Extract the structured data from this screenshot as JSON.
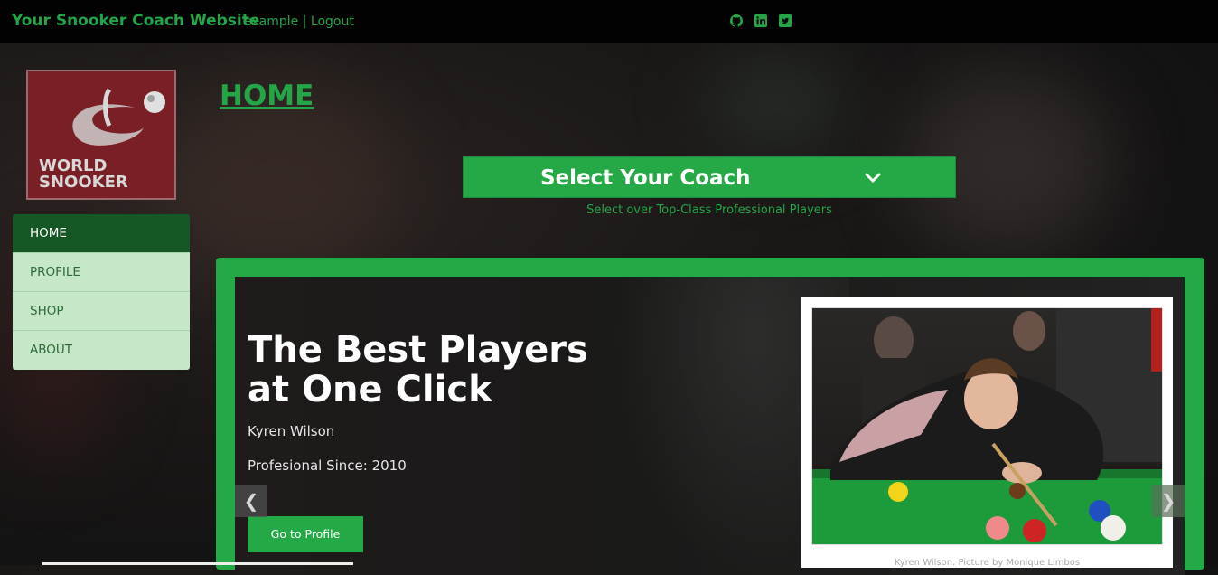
{
  "topbar": {
    "brand": "Your Snooker Coach Website",
    "username": "example",
    "separator": "|",
    "logout": "Logout",
    "social": [
      "github-icon",
      "linkedin-icon",
      "twitter-icon"
    ]
  },
  "logo": {
    "line1": "WORLD",
    "line2": "SNOOKER"
  },
  "sidebar": {
    "items": [
      {
        "label": "HOME",
        "active": true
      },
      {
        "label": "PROFILE",
        "active": false
      },
      {
        "label": "SHOP",
        "active": false
      },
      {
        "label": "ABOUT",
        "active": false
      }
    ]
  },
  "main": {
    "heading": "HOME",
    "coach_select": {
      "label": "Select Your Coach",
      "subtitle": "Select over Top-Class Professional Players"
    },
    "carousel": {
      "title_line1": "The Best Players",
      "title_line2": "at One Click",
      "player_name": "Kyren Wilson",
      "professional_since": "Profesional Since: 2010",
      "button": "Go to Profile",
      "caption": "Kyren Wilson. Picture by Monique Limbos",
      "prev_icon": "chevron-left-icon",
      "next_icon": "chevron-right-icon"
    }
  },
  "colors": {
    "accent": "#25a846",
    "nav_active": "#155725",
    "nav_bg": "#c6e8c8",
    "topbar": "#020202"
  }
}
